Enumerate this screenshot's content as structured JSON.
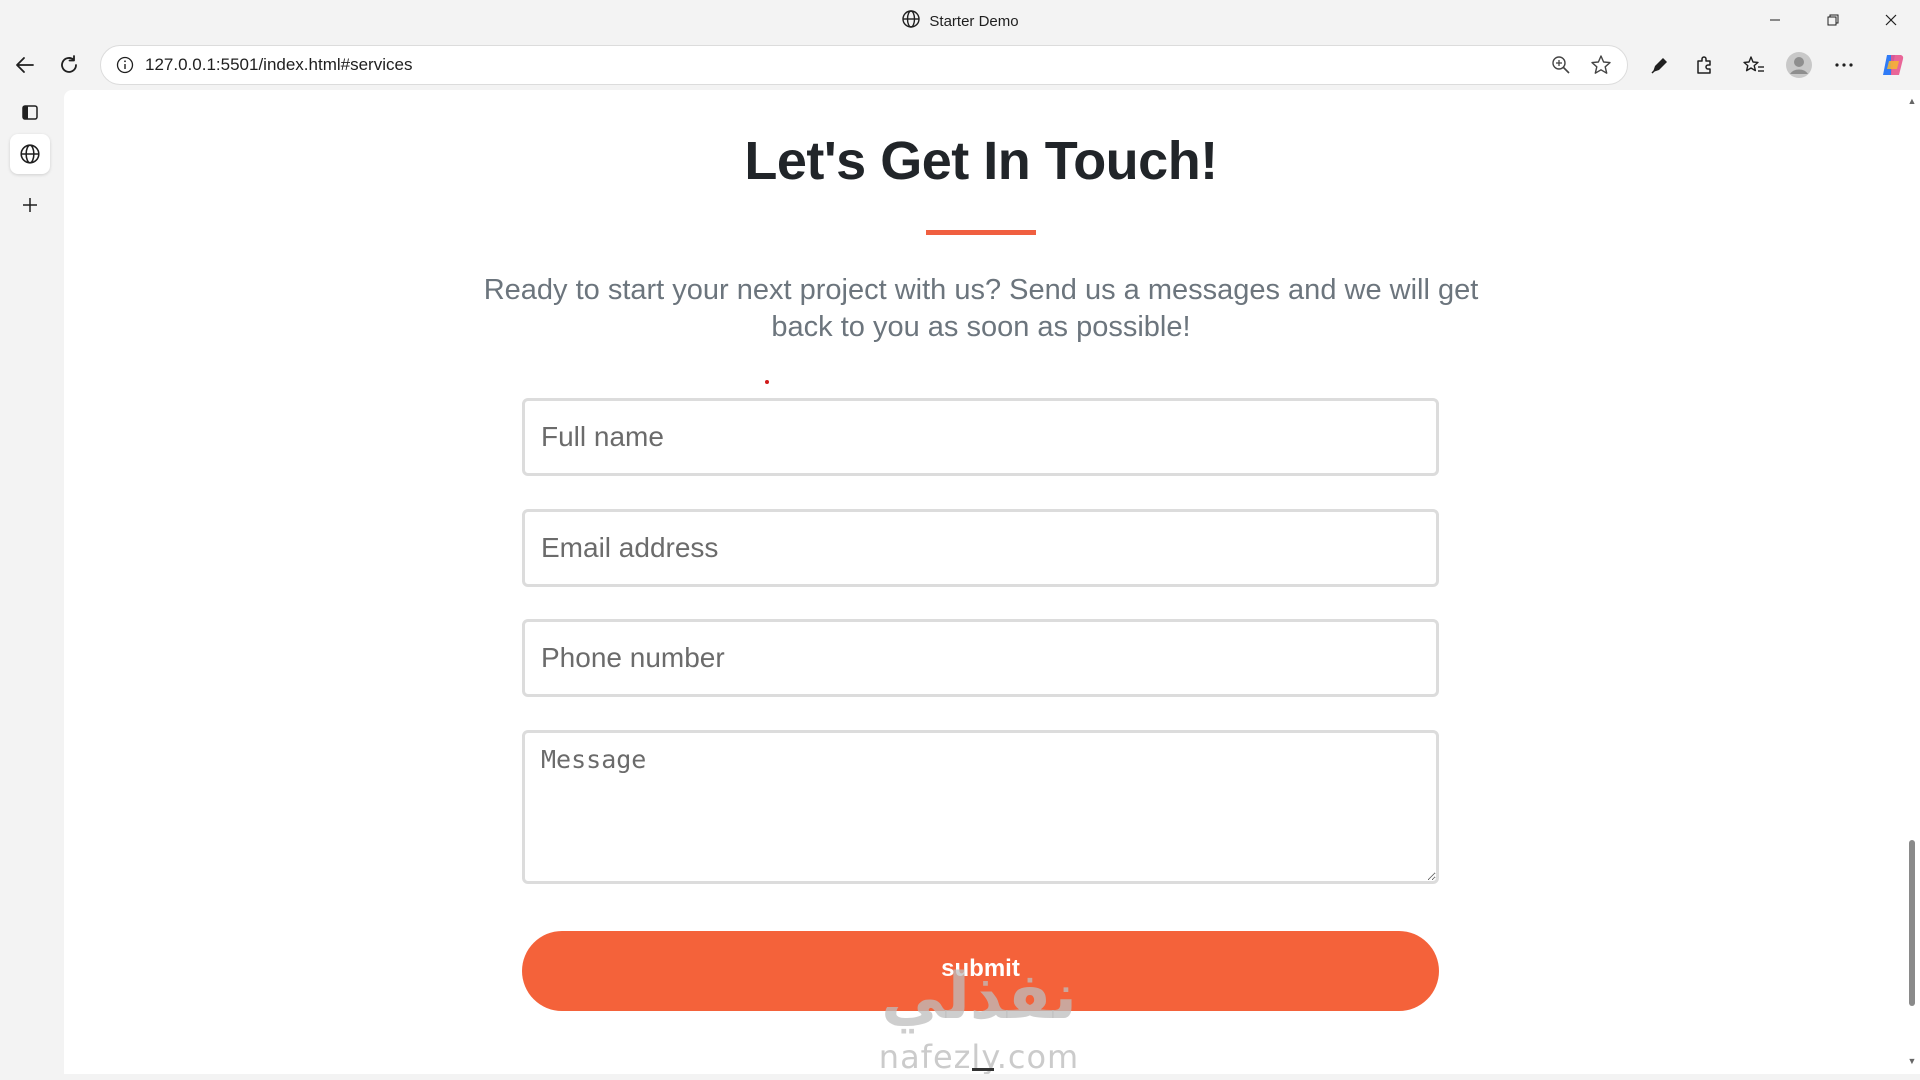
{
  "window": {
    "title": "Starter Demo"
  },
  "browser": {
    "url": "127.0.0.1:5501/index.html#services"
  },
  "page": {
    "heading": "Let's Get In Touch!",
    "lead": "Ready to start your next project with us? Send us a messages and we will get back to you as soon as possible!",
    "accent_color": "#f05f40",
    "form": {
      "full_name_placeholder": "Full name",
      "email_placeholder": "Email address",
      "phone_placeholder": "Phone number",
      "message_placeholder": "Message",
      "submit_label": "submit",
      "button_color": "#f4623a"
    },
    "watermark": {
      "arabic": "نفذلي",
      "latin": "nafezly.com"
    }
  }
}
